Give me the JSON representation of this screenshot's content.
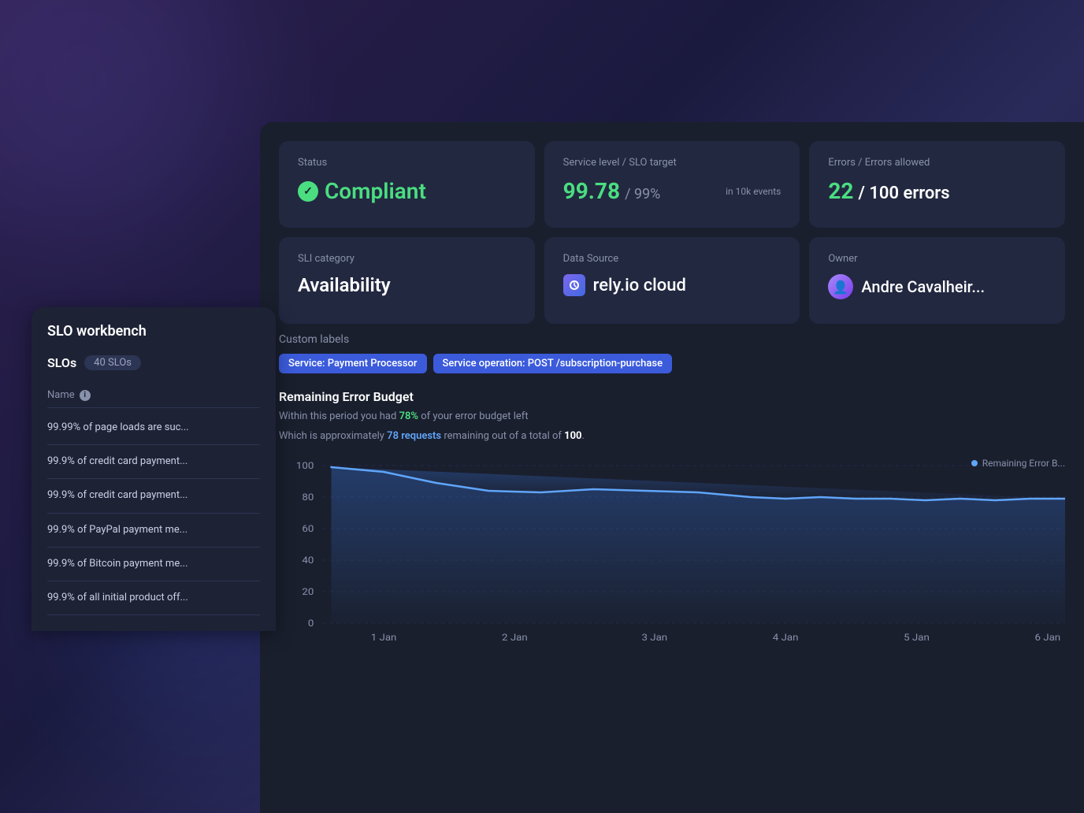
{
  "background": {
    "color": "#2d1f4e"
  },
  "sidebar": {
    "title": "SLO workbench",
    "slos_label": "SLOs",
    "slos_count": "40 SLOs",
    "table_header": "Name",
    "items": [
      {
        "text": "99.99% of page loads are suc..."
      },
      {
        "text": "99.9% of credit card payment..."
      },
      {
        "text": "99.9% of credit card payment..."
      },
      {
        "text": "99.9% of PayPal payment me..."
      },
      {
        "text": "99.9% of Bitcoin payment me..."
      },
      {
        "text": "99.9% of all initial product off..."
      }
    ]
  },
  "metrics": {
    "status": {
      "label": "Status",
      "value": "Compliant",
      "icon": "check-circle"
    },
    "service_level": {
      "label": "Service level / SLO target",
      "value": "99.78",
      "target": "/ 99%",
      "suffix": "in 10k events"
    },
    "errors": {
      "label": "Errors / Errors allowed",
      "value": "22",
      "allowed": "/ 100 errors"
    },
    "sli_category": {
      "label": "SLI category",
      "value": "Availability"
    },
    "data_source": {
      "label": "Data Source",
      "value": "rely.io cloud"
    },
    "owner": {
      "label": "Owner",
      "value": "Andre Cavalheir..."
    }
  },
  "custom_labels": {
    "title": "Custom labels",
    "tags": [
      "Service: Payment Processor",
      "Service operation: POST /subscription-purchase"
    ]
  },
  "error_budget": {
    "title": "Remaining Error Budget",
    "desc1_prefix": "Within this period you had ",
    "desc1_highlight": "78%",
    "desc1_suffix": " of your error budget left",
    "desc2_prefix": "Which is approximately ",
    "desc2_highlight": "78 requests",
    "desc2_middle": " remaining out of a total of ",
    "desc2_bold": "100",
    "desc2_suffix": ".",
    "legend": "Remaining Error B...",
    "chart": {
      "x_labels": [
        "1 Jan",
        "2 Jan",
        "3 Jan",
        "4 Jan",
        "5 Jan",
        "6 Jan"
      ],
      "y_labels": [
        "0",
        "20",
        "40",
        "60",
        "80",
        "100"
      ],
      "start_value": 100,
      "end_value": 78
    }
  }
}
